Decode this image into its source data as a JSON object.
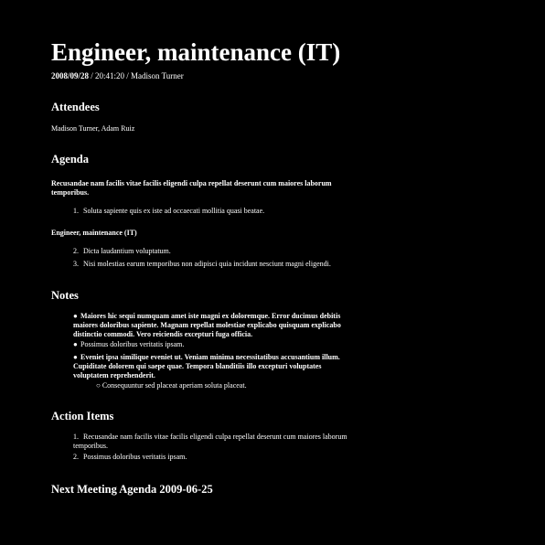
{
  "title": "Engineer, maintenance (IT)",
  "meta": {
    "date": "2008/09/28",
    "rest": " / 20:41:20 / Madison Turner"
  },
  "attendees": {
    "heading": "Attendees",
    "names": "Madison Turner, Adam Ruiz"
  },
  "agenda": {
    "heading": "Agenda",
    "topic1": "Recusandae nam facilis vitae facilis eligendi culpa repellat deserunt cum maiores laborum temporibus.",
    "items1": [
      {
        "num": "1.",
        "text": "Soluta sapiente quis ex iste ad occaecati mollitia quasi beatae."
      }
    ],
    "topic2": "Engineer, maintenance (IT)",
    "items2": [
      {
        "num": "2.",
        "text": "Dicta laudantium voluptatum."
      },
      {
        "num": "3.",
        "text": "Nisi molestias earum temporibus non adipisci quia incidunt nesciunt magni eligendi."
      }
    ]
  },
  "notes": {
    "heading": "Notes",
    "bullets": [
      {
        "marker": "●",
        "text": "Maiores hic sequi numquam amet iste magni ex doloremque. Error ducimus debitis maiores doloribus sapiente. Magnam repellat molestiae explicabo quisquam explicabo distinctio commodi. Vero reiciendis excepturi fuga officia."
      },
      {
        "marker": "●",
        "text": "Possimus doloribus veritatis ipsam."
      },
      {
        "marker": "●",
        "text": "Eveniet ipsa similique eveniet ut. Veniam minima necessitatibus accusantium illum. Cupiditate dolorem qui saepe quae. Tempora blanditiis illo excepturi voluptates voluptatem reprehenderit."
      }
    ],
    "subbullet": {
      "marker": "○",
      "text": "Consequuntur sed placeat aperiam soluta placeat."
    }
  },
  "action_items": {
    "heading": "Action Items",
    "items": [
      {
        "num": "1.",
        "text": "Recusandae nam facilis vitae facilis eligendi culpa repellat deserunt cum maiores laborum temporibus."
      },
      {
        "num": "2.",
        "text": "Possimus doloribus veritatis ipsam."
      }
    ]
  },
  "next_meeting": {
    "heading": "Next Meeting Agenda 2009-06-25"
  }
}
